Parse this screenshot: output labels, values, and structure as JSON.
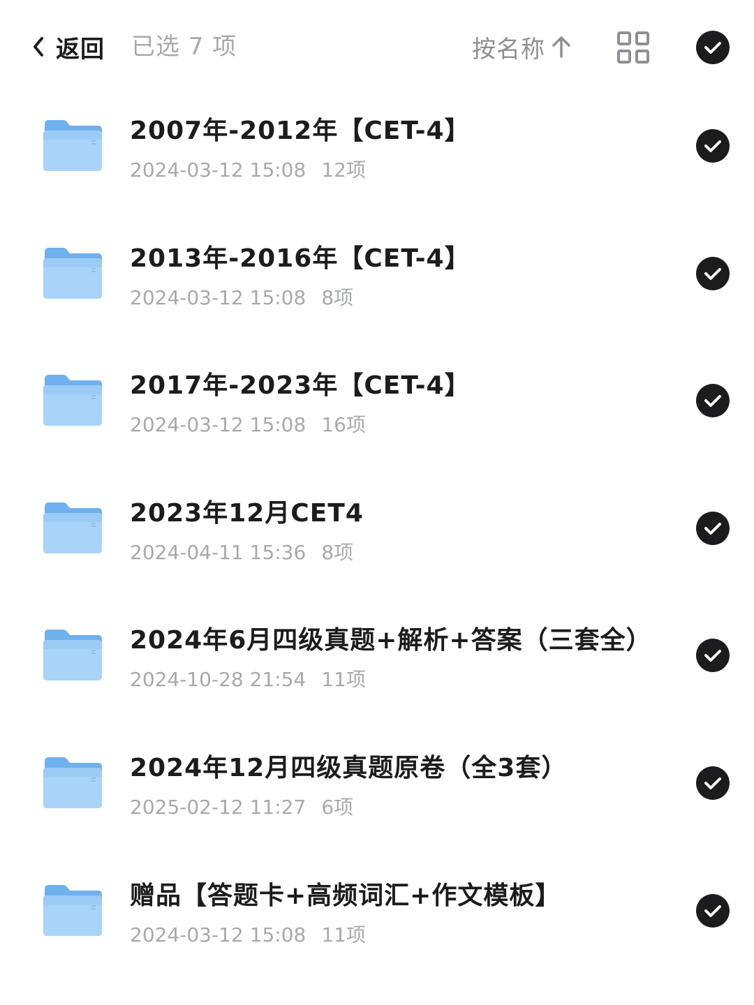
{
  "header": {
    "back_label": "返回",
    "selected_text": "已选 7 项",
    "sort_label": "按名称",
    "sort_icon": "arrow-up-icon",
    "view_toggle_icon": "grid-icon",
    "select_all_icon": "check-circle-icon"
  },
  "colors": {
    "primary_text": "#1c1c1e",
    "secondary_text": "#a7a9ae",
    "folder_blue": "#8dc3f4",
    "check_bg": "#1c1c1e"
  },
  "folders": [
    {
      "name": "2007年-2012年【CET-4】",
      "date": "2024-03-12 15:08",
      "count": "12项",
      "selected": true
    },
    {
      "name": "2013年-2016年【CET-4】",
      "date": "2024-03-12 15:08",
      "count": "8项",
      "selected": true
    },
    {
      "name": "2017年-2023年【CET-4】",
      "date": "2024-03-12 15:08",
      "count": "16项",
      "selected": true
    },
    {
      "name": "2023年12月CET4",
      "date": "2024-04-11 15:36",
      "count": "8项",
      "selected": true
    },
    {
      "name": "2024年6月四级真题+解析+答案（三套全）",
      "date": "2024-10-28 21:54",
      "count": "11项",
      "selected": true
    },
    {
      "name": "2024年12月四级真题原卷（全3套）",
      "date": "2025-02-12 11:27",
      "count": "6项",
      "selected": true
    },
    {
      "name": "赠品【答题卡+高频词汇+作文模板】",
      "date": "2024-03-12 15:08",
      "count": "11项",
      "selected": true
    }
  ]
}
